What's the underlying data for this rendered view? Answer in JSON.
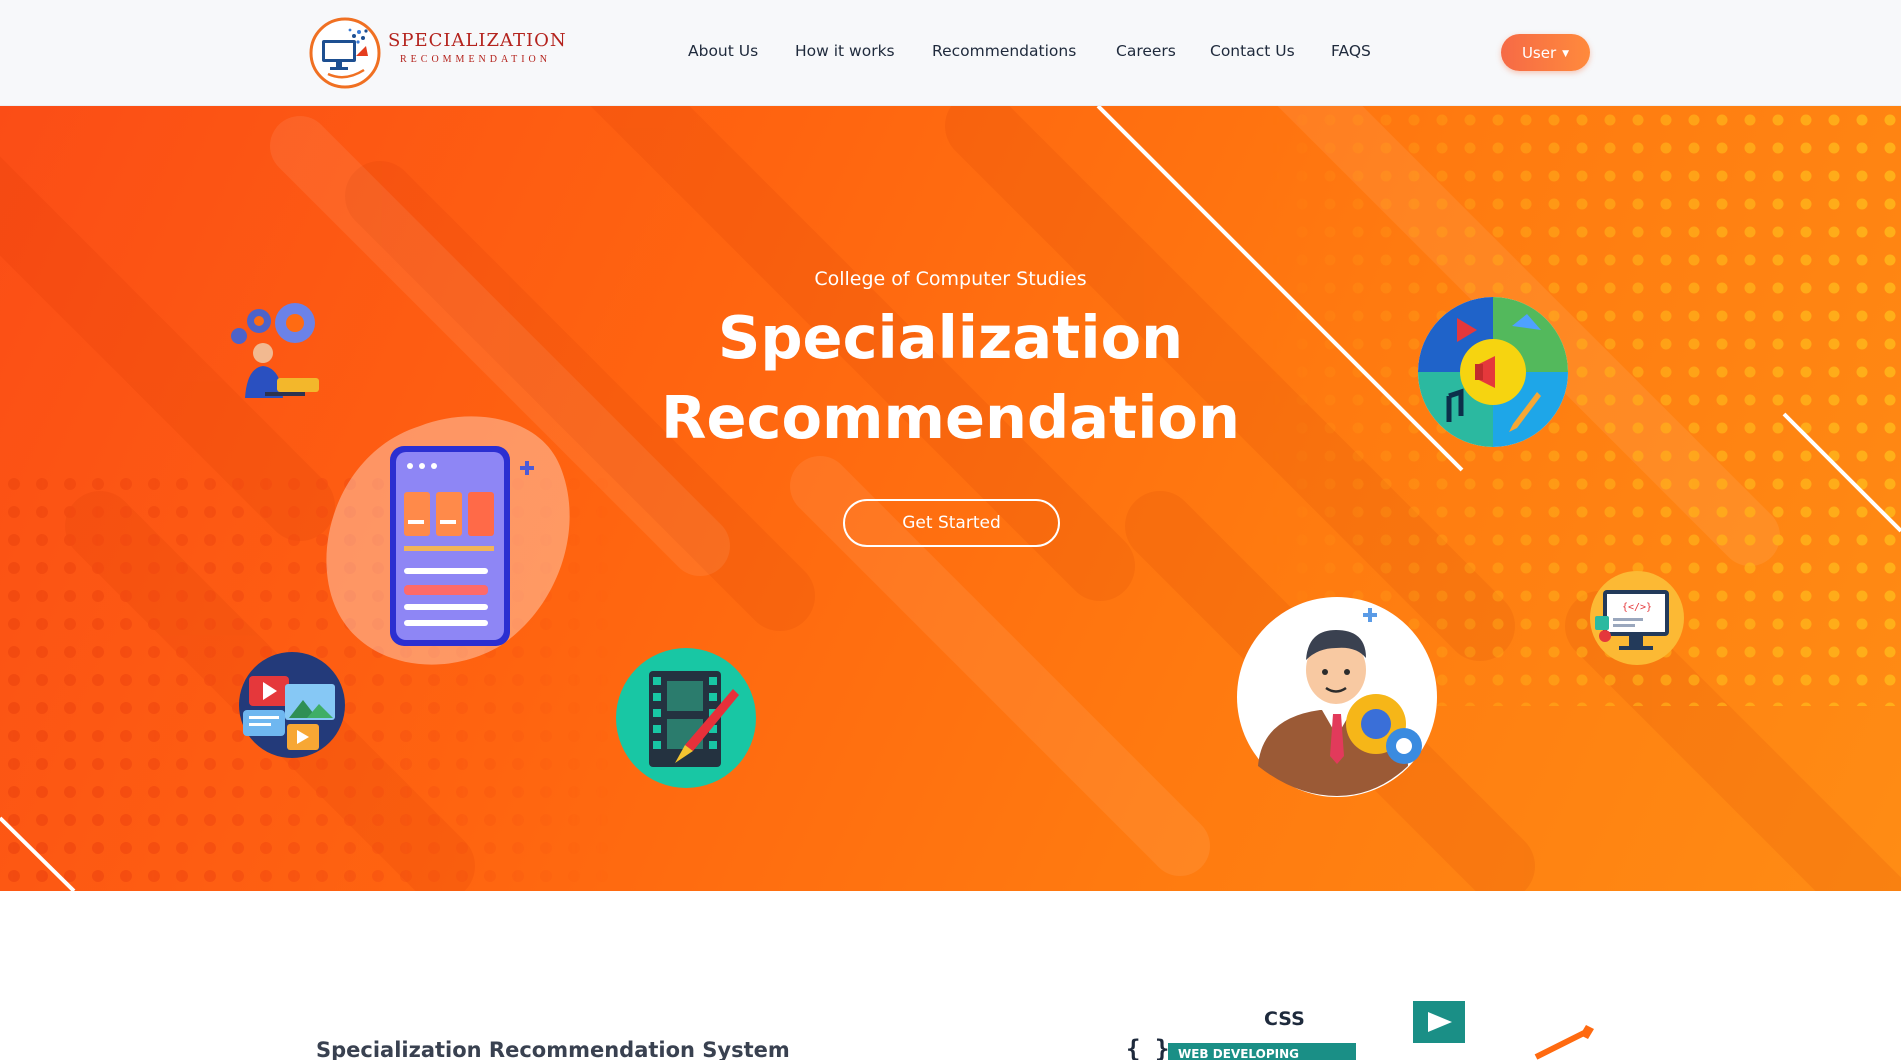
{
  "brand": {
    "name": "SPECIALIZATION",
    "subtitle": "RECOMMENDATION"
  },
  "nav": {
    "items": [
      {
        "label": "About Us"
      },
      {
        "label": "How it works"
      },
      {
        "label": "Recommendations"
      },
      {
        "label": "Careers"
      },
      {
        "label": "Contact Us"
      },
      {
        "label": "FAQS"
      }
    ],
    "user_button": "User"
  },
  "hero": {
    "subtitle": "College of Computer Studies",
    "title_line1": "Specialization",
    "title_line2": "Recommendation",
    "cta": "Get Started"
  },
  "about": {
    "title": "Specialization Recommendation System"
  },
  "illustration": {
    "css_label": "CSS",
    "web_label": "WEB DEVELOPING",
    "code_tag": "{</>}",
    "braces": "{ }"
  },
  "icons": [
    "gear-worker-icon",
    "mobile-app-icon",
    "video-chat-icon",
    "film-edit-icon",
    "businessman-gears-icon",
    "digital-marketing-icon",
    "code-monitor-icon"
  ],
  "colors": {
    "hero_start": "#fb4d16",
    "hero_end": "#ff8c14",
    "accent_button": "#f66a46",
    "nav_text": "#1f2a3c",
    "brand_red": "#b4231d"
  }
}
